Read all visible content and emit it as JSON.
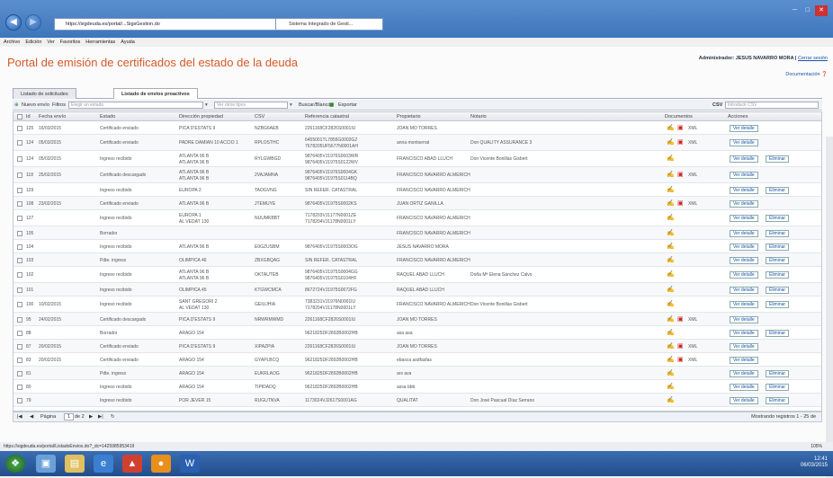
{
  "browser": {
    "address": "https://sigdeuda.es/portal/...SigsGestion.do",
    "tab_title": "Sistema Integrado de Gesti...",
    "menus": [
      "Archivo",
      "Edición",
      "Ver",
      "Favoritos",
      "Herramientas",
      "Ayuda"
    ]
  },
  "header": {
    "title": "Portal de emisión de certificados del estado de la deuda",
    "admin_label": "Administrador: JESUS NAVARRO MORA |",
    "logout": "Cerrar sesión",
    "help": "Documentación"
  },
  "tabs": [
    {
      "label": "Listado de solicitudes"
    },
    {
      "label": "Listado de envíos proactivos"
    }
  ],
  "toolbar": {
    "new": "Nuevo envío",
    "filters": "Filtros",
    "state_placeholder": "Elegir un estado",
    "more_placeholder": "Ver otros tipos",
    "search": "Buscar/Blanco",
    "export": "Exportar",
    "csv_label": "CSV",
    "csv_placeholder": "Introducir CSV"
  },
  "columns": [
    "Id",
    "Fecha envío",
    "Estado",
    "Dirección propiedad",
    "CSV",
    "Referencia catastral",
    "Propietario",
    "Notario",
    "Documentos",
    "Acciones"
  ],
  "rows": [
    {
      "id": "125",
      "fecha": "16/03/2015",
      "estado": "Certificado enviado",
      "dir": "PICA D'ESTATS 9",
      "csv": "NZBG6AEB",
      "ref": "2261168CF2826S0001IU",
      "prop": "JOAN MO TORRES",
      "notario": "",
      "docs": true,
      "eliminar": false
    },
    {
      "id": "124",
      "fecha": "05/03/2015",
      "estado": "Certificado enviado",
      "dir": "PADRE DAMIAN 10 ACCIO 1",
      "csv": "RPLOSTHC",
      "ref": "6455001TL7855G0002GZ / 7678205UF5677N0001AH",
      "prop": "anna montserrat",
      "notario": "Don QUALITY ASSURANCE 3",
      "docs": true,
      "eliminar": false
    },
    {
      "id": "124",
      "fecha": "05/03/2015",
      "estado": "Ingreso recibido",
      "dir": "ATLANTA 96 B / ATLANTA 96 B",
      "csv": "RYLGWBGD",
      "ref": "9876405VJ1976S0003WR / 9876405VJ1975S0122WV",
      "prop": "FRANCISCO ABAD LLUCH",
      "notario": "Don Vicente Bonillas Gisbert",
      "docs": false,
      "eliminar": true
    },
    {
      "id": "118",
      "fecha": "25/02/2015",
      "estado": "Certificado descargado",
      "dir": "ATLANTA 96 B / ATLANTA 96 B",
      "csv": "2VAJAMNA",
      "ref": "9876405VJ1976S0004GK / 9876405VJ1975S0114BQ",
      "prop": "FRANCISCO NAVARRO ALMERICH",
      "notario": "",
      "docs": true,
      "eliminar": false
    },
    {
      "id": "129",
      "fecha": "",
      "estado": "Ingreso recibido",
      "dir": "EUROPA 2",
      "csv": "TAOGVNG",
      "ref": "SIN REFER. CATASTRAL",
      "prop": "FRANCISCO NAVARRO ALMERICH",
      "notario": "",
      "docs": false,
      "eliminar": true
    },
    {
      "id": "108",
      "fecha": "23/02/2015",
      "estado": "Certificado enviado",
      "dir": "ATLANTA 96 B",
      "csv": "JTEMUYE",
      "ref": "9876405VJ1975S0002KS",
      "prop": "JUAN ORTIZ GANILLA",
      "notario": "",
      "docs": true,
      "eliminar": false
    },
    {
      "id": "127",
      "fecha": "",
      "estado": "Ingreso recibido",
      "dir": "EUROPA 1 / AL VEDAT 130",
      "csv": "NUUMKBBT",
      "ref": "7178203VJ1177N0001ZE / 7178204VJ1178N0001LY",
      "prop": "FRANCISCO NAVARRO ALMERICH",
      "notario": "",
      "docs": false,
      "eliminar": true
    },
    {
      "id": "105",
      "fecha": "",
      "estado": "Borrador",
      "dir": "",
      "csv": "",
      "ref": "",
      "prop": "FRANCISCO NAVARRO ALMERICH",
      "notario": "",
      "docs": false,
      "eliminar": true
    },
    {
      "id": "104",
      "fecha": "",
      "estado": "Ingreso recibido",
      "dir": "ATLANTA 96 B",
      "csv": "E0GZUSBM",
      "ref": "9876405VJ1975S0003OG",
      "prop": "JESUS NAVARRO MORA",
      "notario": "",
      "docs": false,
      "eliminar": true
    },
    {
      "id": "103",
      "fecha": "",
      "estado": "Pdte. ingreso",
      "dir": "OLIMPICA 46",
      "csv": "ZBXGBQAG",
      "ref": "SIN REFER. CATASTRAL",
      "prop": "FRANCISCO NAVARRO ALMERICH",
      "notario": "",
      "docs": false,
      "eliminar": true
    },
    {
      "id": "102",
      "fecha": "",
      "estado": "Ingreso recibido",
      "dir": "ATLANTA 96 B / ATLANTA 96 B",
      "csv": "OKTAUTEB",
      "ref": "9876405VJ1975S0004GG / 9876405VJ1975S0104HF",
      "prop": "RAQUEL ABAD LLUCH",
      "notario": "Doña Mª Elena Sánchez Calvo",
      "docs": false,
      "eliminar": true
    },
    {
      "id": "101",
      "fecha": "",
      "estado": "Ingreso recibido",
      "dir": "OLIMPICA 45",
      "csv": "KTGWCMCA",
      "ref": "8672724VJ1975S0072FG",
      "prop": "RAQUEL ABAD LLUCH",
      "notario": "",
      "docs": false,
      "eliminar": true
    },
    {
      "id": "100",
      "fecha": "10/02/2015",
      "estado": "Ingreso recibido",
      "dir": "SANT GREGORI 2 / AL VEDAT 130",
      "csv": "GEIUJHIA",
      "ref": "7383231VJ1976N0001IU / 7178204VJ1178N0001LY",
      "prop": "FRANCISCO NAVARRO ALMERICH",
      "notario": "Don Vicente Bonillas Gisbert",
      "docs": false,
      "eliminar": true
    },
    {
      "id": "95",
      "fecha": "24/02/2015",
      "estado": "Certificado descargado",
      "dir": "PICA D'ESTATS 9",
      "csv": "NRWRMWMD",
      "ref": "2261168CF2826S0001IU",
      "prop": "JOAN MO TORRES",
      "notario": "",
      "docs": true,
      "eliminar": false
    },
    {
      "id": "88",
      "fecha": "",
      "estado": "Borrador",
      "dir": "ARAGO 154",
      "csv": "",
      "ref": "9621825DF2892B0002HB",
      "prop": "asa asa",
      "notario": "",
      "docs": false,
      "eliminar": true
    },
    {
      "id": "87",
      "fecha": "20/02/2015",
      "estado": "Certificado enviado",
      "dir": "PICA D'ESTATS 9",
      "csv": "XIPAZPIA",
      "ref": "2261168CF2826S0001IU",
      "prop": "JOAN MO TORRES",
      "notario": "",
      "docs": true,
      "eliminar": false
    },
    {
      "id": "83",
      "fecha": "20/02/2015",
      "estado": "Certificado enviado",
      "dir": "ARAGO 154",
      "csv": "GYAPLBCQ",
      "ref": "9621825DF2892B0002HB",
      "prop": "ebasca asdfasfas",
      "notario": "",
      "docs": true,
      "eliminar": false
    },
    {
      "id": "81",
      "fecha": "",
      "estado": "Pdte. ingreso",
      "dir": "ARAGO 154",
      "csv": "EUKRLAOG",
      "ref": "9621825DF2892B0002HB",
      "prop": "ars ava",
      "notario": "",
      "docs": false,
      "eliminar": true
    },
    {
      "id": "80",
      "fecha": "",
      "estado": "Ingreso recibido",
      "dir": "ARAGO 154",
      "csv": "TIPIDADQ",
      "ref": "9621825DF2892B0002HB",
      "prop": "assa bbb",
      "notario": "",
      "docs": false,
      "eliminar": true
    },
    {
      "id": "79",
      "fecha": "",
      "estado": "Ingreso recibido",
      "dir": "POR JEVER 15",
      "csv": "RUGUTNVA",
      "ref": "1173024VJ2617S0001AG",
      "prop": "QUALITAT",
      "notario": "Don José Pascual Díaz Serrano",
      "docs": false,
      "eliminar": true
    }
  ],
  "actions": {
    "view": "Ver detalle",
    "delete": "Eliminar"
  },
  "pager": {
    "page_label": "Página",
    "page_value": "1",
    "of": "de 2",
    "showing": "Mostrando registros 1 - 25 de"
  },
  "statusbar": {
    "url": "https://sigdeuda.es/portal/ListadoEnvios.do?_dc=1425985953419",
    "zoom": "105%"
  },
  "taskbar": {
    "time": "12:41",
    "date": "06/03/2015"
  }
}
